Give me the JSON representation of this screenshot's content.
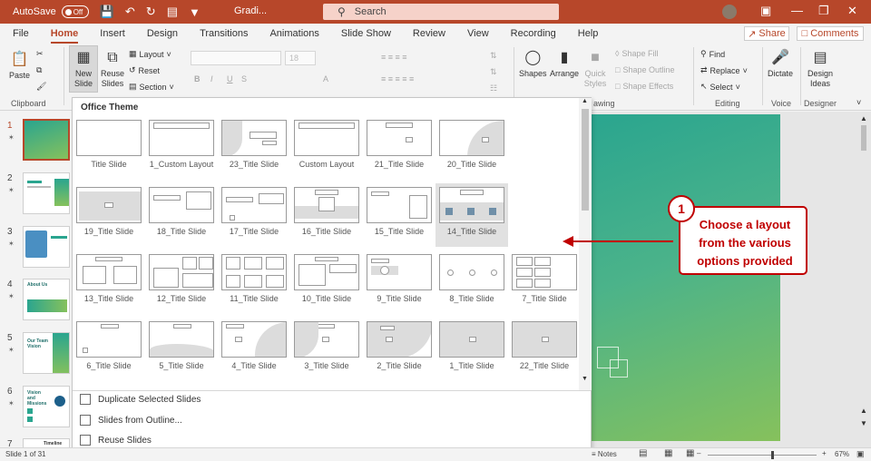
{
  "titlebar": {
    "autosave_label": "AutoSave",
    "autosave_state": "Off",
    "doc_title": "Gradi...",
    "search_placeholder": "Search"
  },
  "tabs": [
    "File",
    "Home",
    "Insert",
    "Design",
    "Transitions",
    "Animations",
    "Slide Show",
    "Review",
    "View",
    "Recording",
    "Help"
  ],
  "active_tab": "Home",
  "share_label": "Share",
  "comments_label": "Comments",
  "ribbon": {
    "paste": "Paste",
    "clipboard": "Clipboard",
    "new_slide": "New Slide",
    "reuse_slides": "Reuse Slides",
    "layout": "Layout",
    "reset": "Reset",
    "section": "Section",
    "font_size": "18",
    "shapes": "Shapes",
    "arrange": "Arrange",
    "quick_styles": "Quick Styles",
    "shape_fill": "Shape Fill",
    "shape_outline": "Shape Outline",
    "shape_effects": "Shape Effects",
    "drawing": "awing",
    "find": "Find",
    "replace": "Replace",
    "select": "Select",
    "editing": "Editing",
    "dictate": "Dictate",
    "voice": "Voice",
    "design_ideas": "Design Ideas",
    "designer": "Designer"
  },
  "slide_numbers": [
    "1",
    "2",
    "3",
    "4",
    "5",
    "6",
    "7"
  ],
  "thumb_texts": {
    "s4": "About Us",
    "s5": "Our Team Vision",
    "s6": "Vision and Missions",
    "s7": "Timeline"
  },
  "dropdown": {
    "header": "Office Theme",
    "layouts": [
      "Title Slide",
      "1_Custom Layout",
      "23_Title Slide",
      "Custom Layout",
      "21_Title Slide",
      "20_Title Slide",
      "19_Title Slide",
      "18_Title Slide",
      "17_Title Slide",
      "16_Title Slide",
      "15_Title Slide",
      "14_Title Slide",
      "13_Title Slide",
      "12_Title Slide",
      "11_Title Slide",
      "10_Title Slide",
      "9_Title Slide",
      "8_Title Slide",
      "7_Title Slide",
      "6_Title Slide",
      "5_Title Slide",
      "4_Title Slide",
      "3_Title Slide",
      "2_Title Slide",
      "1_Title Slide",
      "22_Title Slide"
    ],
    "selected_layout": "14_Title Slide",
    "actions": [
      "Duplicate Selected Slides",
      "Slides from Outline...",
      "Reuse Slides"
    ]
  },
  "callout": {
    "number": "1",
    "line1": "Choose a layout",
    "line2": "from the various",
    "line3": "options provided"
  },
  "status": {
    "slide_info": "Slide 1 of 31",
    "notes": "Notes",
    "zoom": "67%"
  },
  "colors": {
    "accent": "#b7472a",
    "callout": "#c00000"
  }
}
